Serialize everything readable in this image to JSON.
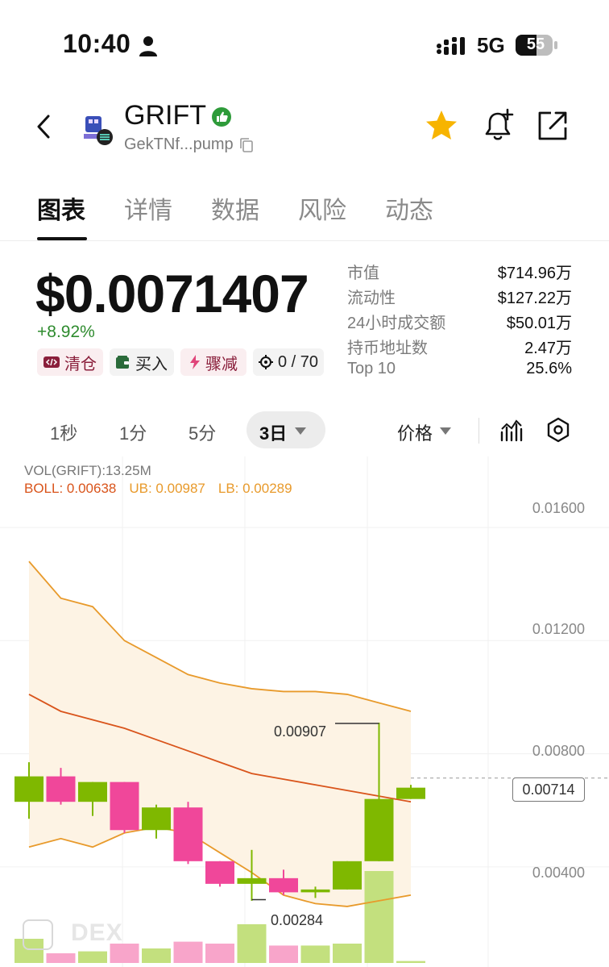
{
  "status_bar": {
    "time": "10:40",
    "network": "5G",
    "battery": "55"
  },
  "header": {
    "token_name": "GRIFT",
    "address": "GekTNf...pump",
    "icons": [
      "back-icon",
      "token-logo",
      "verified-icon",
      "copy-icon",
      "star-icon",
      "bell-plus-icon",
      "share-icon"
    ]
  },
  "tabs": [
    {
      "label": "图表",
      "active": true
    },
    {
      "label": "详情",
      "active": false
    },
    {
      "label": "数据",
      "active": false
    },
    {
      "label": "风险",
      "active": false
    },
    {
      "label": "动态",
      "active": false
    }
  ],
  "price": {
    "value": "$0.0071407",
    "change": "+8.92%"
  },
  "actions": [
    {
      "label": "清仓"
    },
    {
      "label": "买入"
    },
    {
      "label": "骤减"
    },
    {
      "label": "0 / 70"
    }
  ],
  "stats": [
    {
      "label": "市值",
      "value": "$714.96万"
    },
    {
      "label": "流动性",
      "value": "$127.22万"
    },
    {
      "label": "24小时成交额",
      "value": "$50.01万"
    },
    {
      "label": "持币地址数",
      "value": "2.47万"
    },
    {
      "label": "Top 10",
      "value": "25.6%"
    }
  ],
  "toolbar": {
    "intervals": [
      "1秒",
      "1分",
      "5分"
    ],
    "active_interval": "3日",
    "price_type": "价格"
  },
  "colors": {
    "up": "#7fb800",
    "down": "#f0479a",
    "boll_mid": "#d9541b",
    "boll_band": "#e89a2b",
    "band_fill": "#fdf3e4"
  },
  "chart_data": {
    "type": "candlestick",
    "vol_label": "VOL(GRIFT):13.25M",
    "boll": {
      "mid": "BOLL: 0.00638",
      "ub": "UB: 0.00987",
      "lb": "LB: 0.00289"
    },
    "y_ticks": [
      "0.01600",
      "0.01200",
      "0.00800",
      "0.00400"
    ],
    "ylim": [
      0.0014,
      0.0168
    ],
    "last_price": "0.00714",
    "annotations": {
      "high": "0.00907",
      "low": "0.00284"
    },
    "candles": [
      {
        "o": 0.0063,
        "h": 0.0077,
        "l": 0.0057,
        "c": 0.0072,
        "v": 0.25
      },
      {
        "o": 0.0072,
        "h": 0.0075,
        "l": 0.0062,
        "c": 0.0063,
        "v": 0.1
      },
      {
        "o": 0.0063,
        "h": 0.007,
        "l": 0.0058,
        "c": 0.007,
        "v": 0.12
      },
      {
        "o": 0.007,
        "h": 0.007,
        "l": 0.0052,
        "c": 0.0053,
        "v": 0.2
      },
      {
        "o": 0.0053,
        "h": 0.0062,
        "l": 0.005,
        "c": 0.0061,
        "v": 0.15
      },
      {
        "o": 0.0061,
        "h": 0.0063,
        "l": 0.0041,
        "c": 0.0042,
        "v": 0.22
      },
      {
        "o": 0.0042,
        "h": 0.0042,
        "l": 0.0033,
        "c": 0.0034,
        "v": 0.2
      },
      {
        "o": 0.0034,
        "h": 0.0046,
        "l": 0.0028,
        "c": 0.0036,
        "v": 0.4
      },
      {
        "o": 0.0036,
        "h": 0.0039,
        "l": 0.003,
        "c": 0.0031,
        "v": 0.18
      },
      {
        "o": 0.0031,
        "h": 0.0033,
        "l": 0.0029,
        "c": 0.0032,
        "v": 0.18
      },
      {
        "o": 0.0032,
        "h": 0.0042,
        "l": 0.0032,
        "c": 0.0042,
        "v": 0.2
      },
      {
        "o": 0.0042,
        "h": 0.0091,
        "l": 0.0042,
        "c": 0.0064,
        "v": 0.95
      },
      {
        "o": 0.0064,
        "h": 0.0069,
        "l": 0.0064,
        "c": 0.0068,
        "v": 0.02
      }
    ],
    "boll_ub": [
      0.0148,
      0.0135,
      0.0132,
      0.012,
      0.0114,
      0.0108,
      0.0105,
      0.0103,
      0.0102,
      0.0102,
      0.0101,
      0.0098,
      0.0095
    ],
    "boll_mid": [
      0.0101,
      0.0095,
      0.0092,
      0.0089,
      0.0085,
      0.0081,
      0.0077,
      0.0073,
      0.0071,
      0.0069,
      0.0067,
      0.0065,
      0.0063
    ],
    "boll_lb": [
      0.0047,
      0.005,
      0.0047,
      0.0052,
      0.0054,
      0.0052,
      0.0045,
      0.0038,
      0.003,
      0.0027,
      0.0026,
      0.0028,
      0.003
    ]
  }
}
